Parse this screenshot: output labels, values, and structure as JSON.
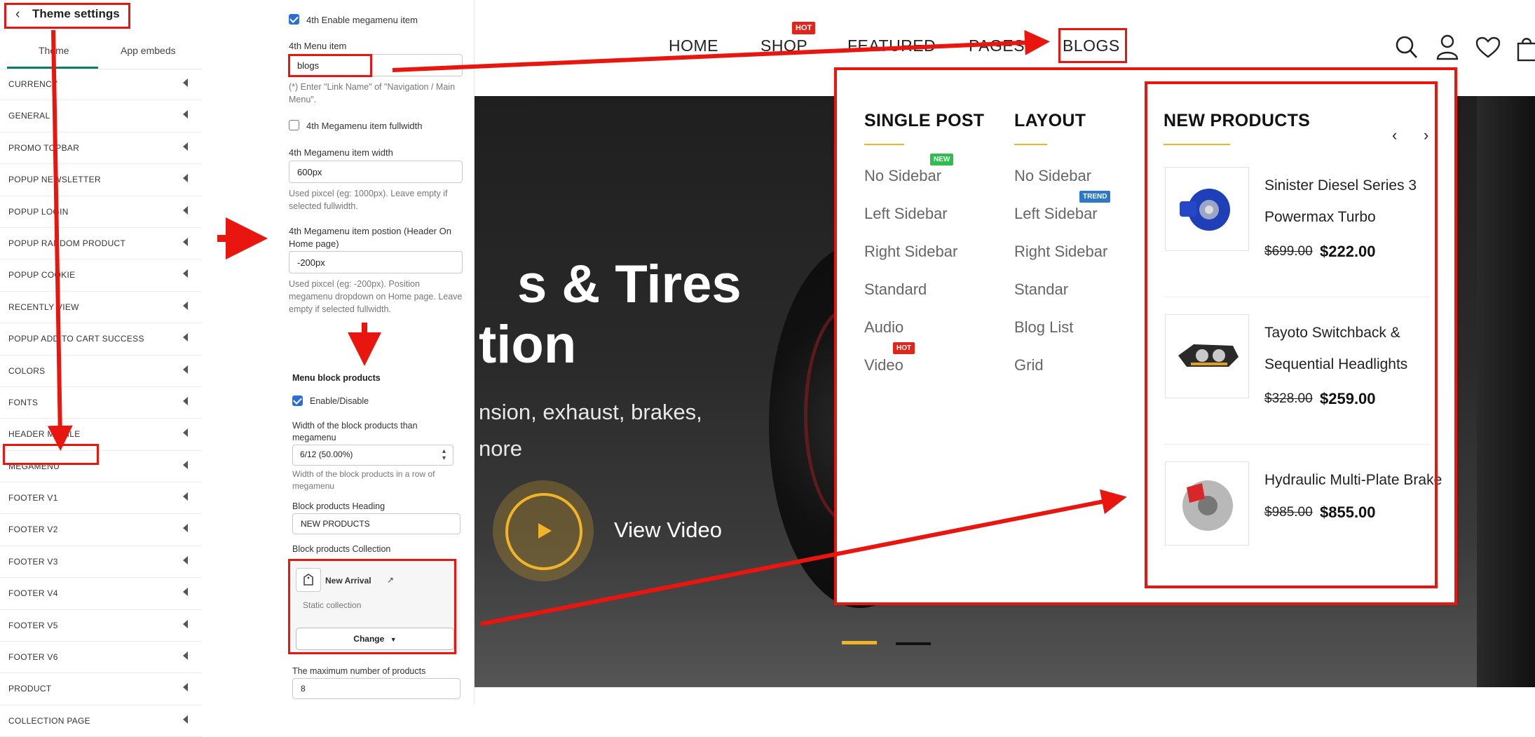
{
  "sidebar": {
    "title": "Theme settings",
    "tabs": [
      "Theme",
      "App embeds"
    ],
    "items": [
      "CURRENCY",
      "GENERAL",
      "PROMO TOPBAR",
      "POPUP NEWSLETTER",
      "POPUP LOGIN",
      "POPUP RANDOM PRODUCT",
      "POPUP COOKIE",
      "RECENTLY VIEW",
      "POPUP ADD TO CART SUCCESS",
      "COLORS",
      "FONTS",
      "HEADER MOBILE",
      "MEGAMENU",
      "FOOTER V1",
      "FOOTER V2",
      "FOOTER V3",
      "FOOTER V4",
      "FOOTER V5",
      "FOOTER V6",
      "PRODUCT",
      "COLLECTION PAGE"
    ]
  },
  "panel": {
    "enable_label": "4th Enable megamenu item",
    "menu_item_label": "4th Menu item",
    "menu_item_value": "blogs",
    "menu_item_help": "(*) Enter \"Link Name\" of \"Navigation / Main Menu\".",
    "fullwidth_label": "4th Megamenu item fullwidth",
    "width_label": "4th Megamenu item width",
    "width_value": "600px",
    "width_help": "Used pixcel (eg: 1000px). Leave empty if selected fullwidth.",
    "position_label": "4th Megamenu item postion (Header On Home page)",
    "position_value": "-200px",
    "position_help": "Used pixcel (eg: -200px). Position megamenu dropdown on Home page. Leave empty if selected fullwidth.",
    "block_heading": "Menu block products",
    "enable_disable_label": "Enable/Disable",
    "block_width_label": "Width of the block products than megamenu",
    "block_width_value": "6/12 (50.00%)",
    "block_width_help": "Width of the block products in a row of megamenu",
    "products_heading_label": "Block products Heading",
    "products_heading_value": "NEW PRODUCTS",
    "collection_label": "Block products Collection",
    "collection_name": "New Arrival",
    "collection_type": "Static collection",
    "change_label": "Change",
    "max_products_label": "The maximum number of products",
    "max_products_value": "8"
  },
  "site": {
    "nav": [
      "HOME",
      "SHOP",
      "FEATURED",
      "PAGES",
      "BLOGS"
    ],
    "hot_badge": "HOT",
    "hero_line1": "s & Tires",
    "hero_line2": "tion",
    "hero_sub1": "nsion, exhaust, brakes,",
    "hero_sub2": "nore",
    "view_video": "View Video"
  },
  "mega": {
    "col1_head": "SINGLE POST",
    "col1_links": [
      "No Sidebar",
      "Left Sidebar",
      "Right Sidebar",
      "Standard",
      "Audio",
      "Video"
    ],
    "col2_head": "LAYOUT",
    "col2_links": [
      "No Sidebar",
      "Left Sidebar",
      "Right Sidebar",
      "Standar",
      "Blog List",
      "Grid"
    ],
    "badge_new": "NEW",
    "badge_trend": "TREND",
    "badge_hot": "HOT",
    "products_head": "NEW PRODUCTS",
    "products": [
      {
        "name_line1": "Sinister Diesel Series 3",
        "name_line2": "Powermax Turbo",
        "old_price": "$699.00",
        "price": "$222.00"
      },
      {
        "name_line1": "Tayoto Switchback &",
        "name_line2": "Sequential Headlights",
        "old_price": "$328.00",
        "price": "$259.00"
      },
      {
        "name_line1": "Hydraulic Multi-Plate Brake",
        "name_line2": "",
        "old_price": "$985.00",
        "price": "$855.00"
      }
    ]
  },
  "colors": {
    "annotation_red": "#e8160f",
    "accent_gold": "#f0b429",
    "checkbox_blue": "#2b6fd6",
    "tab_green": "#0e7c6b"
  },
  "icons": [
    "back-arrow-icon",
    "search-icon",
    "user-icon",
    "heart-icon",
    "cart-icon",
    "play-icon",
    "external-link-icon",
    "collection-icon",
    "chevron-left-icon",
    "chevron-right-icon"
  ]
}
